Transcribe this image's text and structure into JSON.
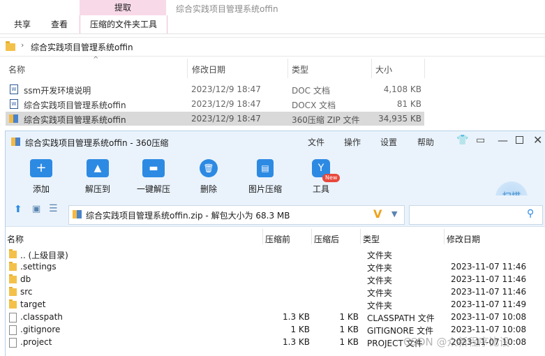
{
  "explorer": {
    "context_group": "提取",
    "context_tab": "压缩的文件夹工具",
    "window_title": "综合实践项目管理系统offin",
    "tabs": [
      "共享",
      "查看"
    ],
    "address": "综合实践项目管理系统offin",
    "columns": {
      "name": "名称",
      "date": "修改日期",
      "type": "类型",
      "size": "大小"
    },
    "files": [
      {
        "name": "ssm开发环境说明",
        "date": "2023/12/9 18:47",
        "type": "DOC 文档",
        "size": "4,108 KB",
        "icon": "word-doc-icon",
        "selected": false
      },
      {
        "name": "综合实践项目管理系统offin",
        "date": "2023/12/9 18:47",
        "type": "DOCX 文档",
        "size": "81 KB",
        "icon": "word-doc-icon",
        "selected": false
      },
      {
        "name": "综合实践项目管理系统offin",
        "date": "2023/12/9 18:47",
        "type": "360压缩 ZIP 文件",
        "size": "34,935 KB",
        "icon": "zip-archive-icon",
        "selected": true
      }
    ]
  },
  "zip360": {
    "title": "综合实践项目管理系统offin - 360压缩",
    "menu": [
      "文件",
      "操作",
      "设置",
      "帮助"
    ],
    "toolbar": [
      {
        "label": "添加",
        "icon": "add-icon"
      },
      {
        "label": "解压到",
        "icon": "extract-to-icon"
      },
      {
        "label": "一键解压",
        "icon": "one-click-extract-icon"
      },
      {
        "label": "删除",
        "icon": "delete-icon"
      },
      {
        "label": "图片压缩",
        "icon": "image-compress-icon"
      },
      {
        "label": "工具",
        "icon": "tools-icon"
      }
    ],
    "new_badge": "New",
    "scan_label": "扫描",
    "path": "综合实践项目管理系统offin.zip - 解包大小为 68.3 MB",
    "columns": {
      "name": "名称",
      "compressed": "压缩前",
      "after": "压缩后",
      "type": "类型",
      "date": "修改日期"
    },
    "rows": [
      {
        "name": ".. (上级目录)",
        "before": "",
        "after": "",
        "type": "文件夹",
        "date": "",
        "kind": "folder"
      },
      {
        "name": ".settings",
        "before": "",
        "after": "",
        "type": "文件夹",
        "date": "2023-11-07 11:46",
        "kind": "folder"
      },
      {
        "name": "db",
        "before": "",
        "after": "",
        "type": "文件夹",
        "date": "2023-11-07 11:46",
        "kind": "folder"
      },
      {
        "name": "src",
        "before": "",
        "after": "",
        "type": "文件夹",
        "date": "2023-11-07 11:46",
        "kind": "folder"
      },
      {
        "name": "target",
        "before": "",
        "after": "",
        "type": "文件夹",
        "date": "2023-11-07 11:49",
        "kind": "folder"
      },
      {
        "name": ".classpath",
        "before": "1.3 KB",
        "after": "1 KB",
        "type": "CLASSPATH 文件",
        "date": "2023-11-07 10:08",
        "kind": "file"
      },
      {
        "name": ".gitignore",
        "before": "1 KB",
        "after": "1 KB",
        "type": "GITIGNORE 文件",
        "date": "2023-11-07 10:08",
        "kind": "file"
      },
      {
        "name": ".project",
        "before": "1.3 KB",
        "after": "1 KB",
        "type": "PROJECT 文件",
        "date": "2023-11-07 10:08",
        "kind": "file"
      }
    ]
  },
  "watermark": "CSDN @众新程序比设"
}
